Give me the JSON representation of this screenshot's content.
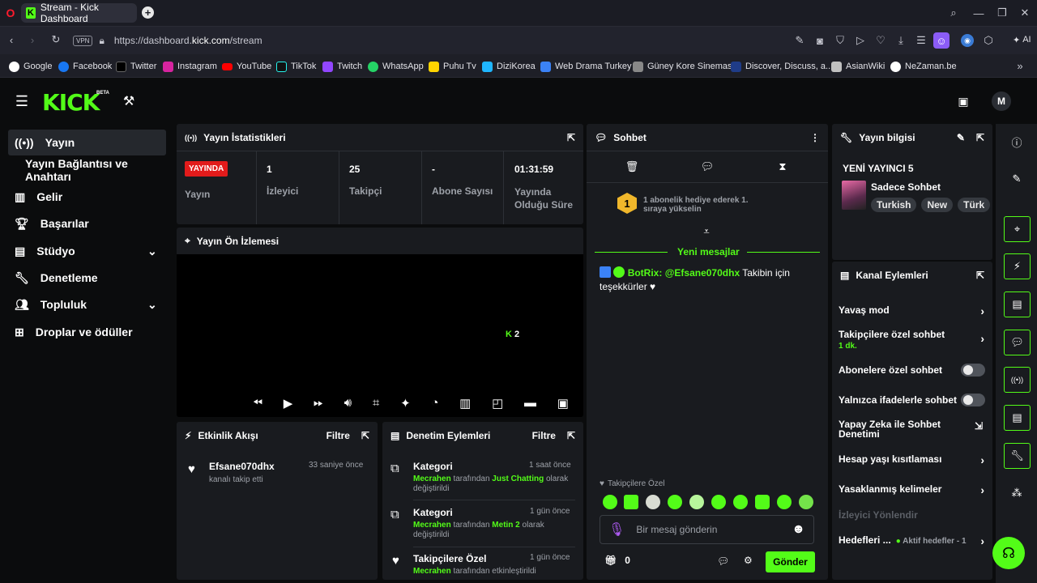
{
  "browser": {
    "tab_title": "Stream - Kick Dashboard",
    "url_prefix": "https://dashboard.",
    "url_domain": "kick.com",
    "url_path": "/stream",
    "vpn": "VPN",
    "ai": "AI"
  },
  "bookmarks": [
    "Google",
    "Facebook",
    "Twitter",
    "Instagram",
    "YouTube",
    "TikTok",
    "Twitch",
    "WhatsApp",
    "Puhu Tv",
    "DiziKorea",
    "Web Drama Turkey",
    "Güney Kore Sineması",
    "Discover, Discuss, a...",
    "AsianWiki",
    "NeZaman.be"
  ],
  "header": {
    "logo": "KICK",
    "beta": "BETA"
  },
  "sidebar": {
    "items": [
      {
        "label": "Yayın"
      },
      {
        "label": "Yayın Bağlantısı ve Anahtarı"
      },
      {
        "label": "Gelir"
      },
      {
        "label": "Başarılar"
      },
      {
        "label": "Stüdyo"
      },
      {
        "label": "Denetleme"
      },
      {
        "label": "Topluluk"
      },
      {
        "label": "Droplar ve ödüller"
      }
    ]
  },
  "stats": {
    "title": "Yayın İstatistikleri",
    "live_badge": "YAYINDA",
    "live_label": "Yayın",
    "viewers_value": "1",
    "viewers_label": "İzleyici",
    "followers_value": "25",
    "followers_label": "Takipçi",
    "subs_value": "-",
    "subs_label": "Abone Sayısı",
    "duration_value": "01:31:59",
    "duration_label": "Yayında Olduğu Süre"
  },
  "preview": {
    "title": "Yayın Ön İzlemesi",
    "viewer_count": "2"
  },
  "activity": {
    "title": "Etkinlik Akışı",
    "filter": "Filtre",
    "user": "Efsane070dhx",
    "time": "33 saniye önce",
    "desc": "kanalı takip etti"
  },
  "moderation": {
    "title": "Denetim Eylemleri",
    "filter": "Filtre",
    "items": [
      {
        "title": "Kategori",
        "time": "1 saat önce",
        "user": "Mecrahen",
        "mid": "tarafından",
        "target": "Just Chatting",
        "end": "olarak değiştirildi"
      },
      {
        "title": "Kategori",
        "time": "1 gün önce",
        "user": "Mecrahen",
        "mid": "tarafından",
        "target": "Metin 2",
        "end": "olarak değiştirildi"
      },
      {
        "title": "Takipçilere Özel",
        "time": "1 gün önce",
        "user": "Mecrahen",
        "mid": "tarafından etkinleştirildi"
      }
    ]
  },
  "chat": {
    "title": "Sohbet",
    "rank": "1",
    "gift_text": "1 abonelik hediye ederek 1. sıraya yükselin",
    "new_messages": "Yeni mesajlar",
    "msg_user": "BotRix:",
    "msg_mention": "@Efsane070dhx",
    "msg_text": "Takibin için teşekkürler ♥",
    "followers_only": "Takipçilere Özel",
    "placeholder": "Bir mesaj gönderin",
    "points": "0",
    "send": "Gönder"
  },
  "info": {
    "title": "Yayın bilgisi",
    "stream_title": "YENİ YAYINCI 5",
    "category": "Sadece Sohbet",
    "tags": [
      "Turkish",
      "New",
      "Türk"
    ]
  },
  "actions": {
    "title": "Kanal Eylemleri",
    "slow": "Yavaş mod",
    "followers_chat": "Takipçilere özel sohbet",
    "followers_chat_sub": "1 dk.",
    "subs_chat": "Abonelere özel sohbet",
    "emote_chat": "Yalnızca ifadelerle sohbet",
    "ai_mod": "Yapay Zeka ile Sohbet Denetimi",
    "age": "Hesap yaşı kısıtlaması",
    "banned": "Yasaklanmış kelimeler",
    "viewer_guide": "İzleyici Yönlendir",
    "goals": "Hedefleri ...",
    "goals_sub": "Aktif hedefler - 1"
  },
  "colors": {
    "accent": "#53fc18",
    "live": "#e21b1b",
    "panel": "#191b1f"
  }
}
